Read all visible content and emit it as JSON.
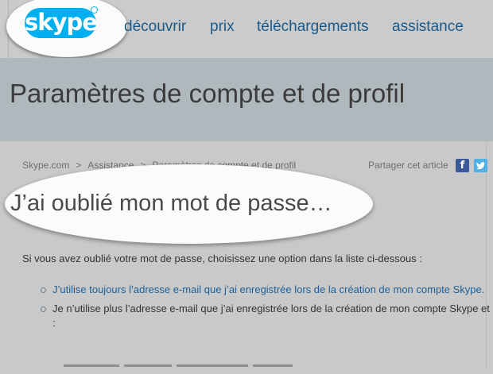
{
  "logo": {
    "text": "skype"
  },
  "nav": {
    "links": [
      "découvrir",
      "prix",
      "téléchargements",
      "assistance"
    ]
  },
  "banner": {
    "title": "Paramètres de compte et de profil"
  },
  "breadcrumb": {
    "items": [
      "Skype.com",
      "Assistance",
      "Paramètres de compte et de profil"
    ],
    "separator": ">"
  },
  "share": {
    "label": "Partager cet article",
    "icons": [
      "facebook-icon",
      "twitter-icon"
    ],
    "facebook_glyph": "f"
  },
  "article": {
    "title": "J’ai oublié mon mot de passe…",
    "intro": "Si vous avez oublié votre mot de passe, choisissez une option dans la liste ci-dessous :",
    "options": [
      {
        "text": "J’utilise toujours l’adresse e-mail que j’ai enregistrée lors de la création de mon compte Skype.",
        "is_link": true
      },
      {
        "text": "Je n’utilise plus l’adresse e-mail que j’ai enregistrée lors de la création de mon compte Skype et :",
        "is_link": false
      }
    ]
  },
  "colors": {
    "brand": "#00aff0",
    "link": "#1d5f96",
    "facebook": "#3b5998",
    "twitter": "#4fb0e6"
  }
}
